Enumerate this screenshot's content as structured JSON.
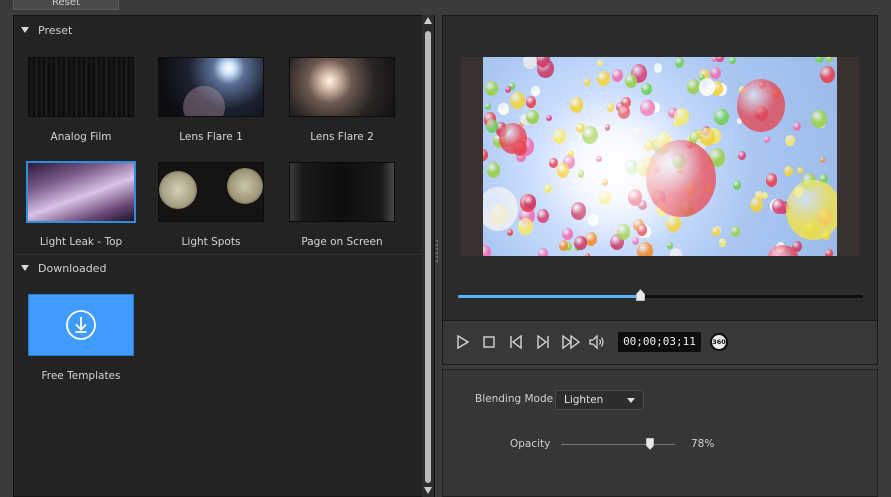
{
  "toolbar": {
    "reset_label": "Reset"
  },
  "library": {
    "preset_section": {
      "title": "Preset",
      "items": [
        {
          "label": "Analog Film",
          "selected": false
        },
        {
          "label": "Lens Flare 1",
          "selected": false
        },
        {
          "label": "Lens Flare 2",
          "selected": false
        },
        {
          "label": "Light Leak - Top",
          "selected": true
        },
        {
          "label": "Light Spots",
          "selected": false
        },
        {
          "label": "Page on Screen",
          "selected": false
        }
      ]
    },
    "downloaded_section": {
      "title": "Downloaded",
      "items": [
        {
          "label": "Free Templates",
          "icon": "download-icon"
        }
      ]
    }
  },
  "preview": {
    "progress_fraction": 0.45,
    "timecode": "00;00;03;11",
    "vr_label": "360"
  },
  "properties": {
    "blending_mode_label": "Blending Mode",
    "blending_mode_value": "Lighten",
    "opacity_label": "Opacity",
    "opacity_value": "78%",
    "opacity_fraction": 0.78
  },
  "colors": {
    "accent": "#3f9bff",
    "selection_border": "#2e8fe0",
    "progress_fill": "#5ab4ff"
  }
}
